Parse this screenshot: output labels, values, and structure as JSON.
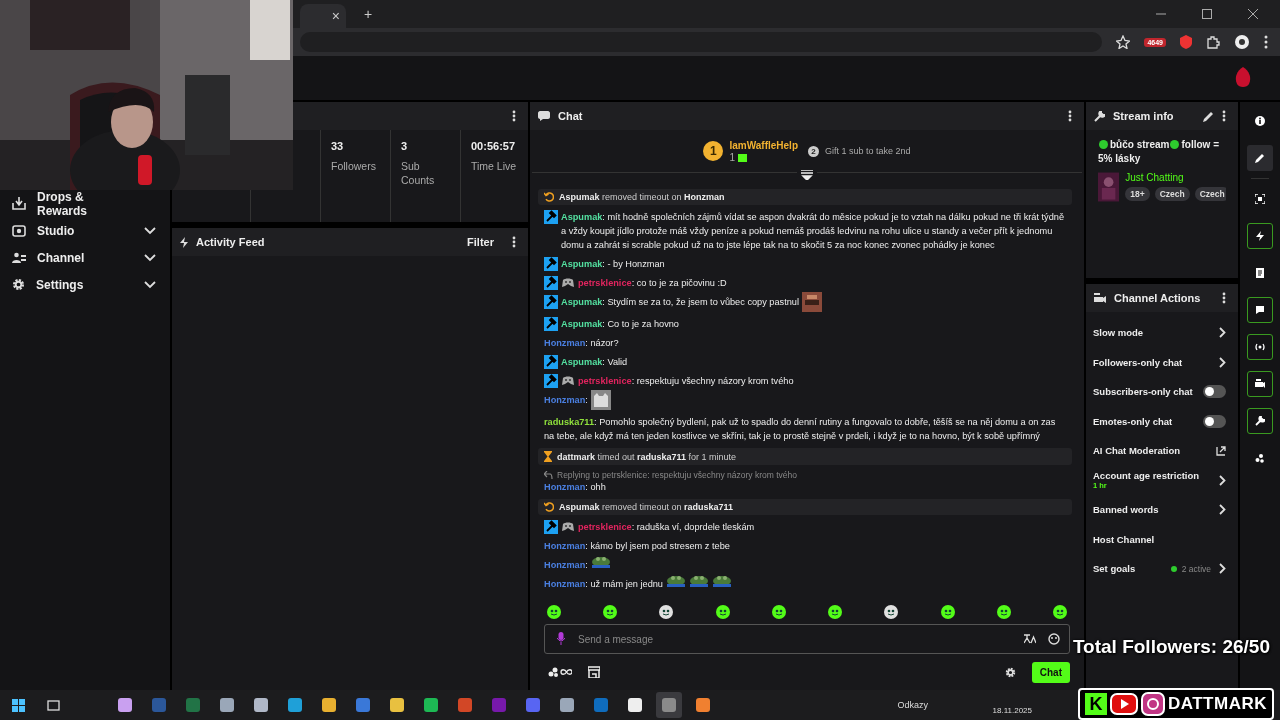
{
  "browser": {
    "tab_close": "×",
    "new_tab": "+",
    "extension_badge": "4649"
  },
  "sidebar": {
    "items": [
      {
        "label": "Drops & Rewards",
        "expandable": false
      },
      {
        "label": "Studio",
        "expandable": true
      },
      {
        "label": "Channel",
        "expandable": true
      },
      {
        "label": "Settings",
        "expandable": true
      }
    ]
  },
  "stats": [
    {
      "value": "33",
      "label": "Followers"
    },
    {
      "value": "3",
      "label": "Sub Counts"
    },
    {
      "value": "00:56:57",
      "label": "Time Live"
    }
  ],
  "activity_feed": {
    "title": "Activity Feed",
    "filter": "Filter"
  },
  "chat": {
    "title": "Chat",
    "leaderboard": {
      "rank": "1",
      "name": "IamWaffleHelp",
      "count": "1",
      "next_rank": "2",
      "hint": "Gift 1 sub to take 2nd"
    },
    "messages": [
      {
        "kind": "unban",
        "text": "**Aspumak** removed timeout on **Honzman**"
      },
      {
        "kind": "message",
        "mod": true,
        "extra_badge": false,
        "user": "Aspumak",
        "color": "#53e0a0",
        "text": ": mít hodně společních zájmů vídat se aspon dvakrát do měsice pokud je to vztah na dálku pokud ne tři krát týdně a vždy koupit jídlo protože máš vždy peníze a pokud nemáš prodáš ledvinu na rohu ulice u standy a večer přít k jednomu domu a zahrát si scrable pokud už na to jste lépe tak na to skočit 5 za noc konec zvonec pohádky je konec"
      },
      {
        "kind": "message",
        "mod": true,
        "extra_badge": false,
        "user": "Aspumak",
        "color": "#53e0a0",
        "text": ": - by Honzman"
      },
      {
        "kind": "message",
        "mod": true,
        "extra_badge": true,
        "user": "petrsklenice",
        "color": "#e0245e",
        "text": ": co to je za pičovinu :D"
      },
      {
        "kind": "message",
        "mod": true,
        "extra_badge": false,
        "user": "Aspumak",
        "color": "#53e0a0",
        "text": ": Stydím se za to, že jsem to vůbec copy pastnul",
        "emotes": [
          {
            "kind": "face"
          }
        ]
      },
      {
        "kind": "message",
        "mod": true,
        "extra_badge": false,
        "user": "Aspumak",
        "color": "#53e0a0",
        "text": ": Co to je za hovno"
      },
      {
        "kind": "message",
        "mod": false,
        "extra_badge": false,
        "user": "Honzman",
        "color": "#4a7fe0",
        "text": ": názor?"
      },
      {
        "kind": "message",
        "mod": true,
        "extra_badge": false,
        "user": "Aspumak",
        "color": "#53e0a0",
        "text": ": Valid"
      },
      {
        "kind": "message",
        "mod": true,
        "extra_badge": true,
        "user": "petrsklenice",
        "color": "#e0245e",
        "text": ": respektuju všechny názory krom tvého"
      },
      {
        "kind": "message",
        "mod": false,
        "extra_badge": false,
        "user": "Honzman",
        "color": "#4a7fe0",
        "text": ":",
        "emotes": [
          {
            "kind": "cat"
          }
        ]
      },
      {
        "kind": "message",
        "mod": false,
        "extra_badge": false,
        "user": "raduska711",
        "color": "#8fe03c",
        "text": ": Pomohlo společný bydlení, pak už to spadlo do denní rutiny a fungovalo to dobře, těšíš se na něj domu a on zas na tebe, ale když má ten jeden kostlivce ve skříni, tak je to prostě stejně v prdeli, i když je to na hovno, být k sobě upřímný"
      },
      {
        "kind": "timeout",
        "text": "**dattmark** timed out **raduska711** for 1 minute"
      },
      {
        "kind": "message",
        "mod": false,
        "extra_badge": false,
        "reply": "Replying to petrsklenice: respektuju všechny názory krom tvého",
        "user": "Honzman",
        "color": "#4a7fe0",
        "text": ": ohh"
      },
      {
        "kind": "unban",
        "text": "**Aspumak** removed timeout on **raduska711**"
      },
      {
        "kind": "message",
        "mod": true,
        "extra_badge": true,
        "user": "petrsklenice",
        "color": "#e0245e",
        "text": ": raduška ví, doprdele tleskám"
      },
      {
        "kind": "message",
        "mod": false,
        "extra_badge": false,
        "user": "Honzman",
        "color": "#4a7fe0",
        "text": ": kámo byl jsem pod stresem z tebe"
      },
      {
        "kind": "message",
        "mod": false,
        "extra_badge": false,
        "user": "Honzman",
        "color": "#4a7fe0",
        "text": ":",
        "emotes": [
          {
            "kind": "frog"
          }
        ]
      },
      {
        "kind": "message",
        "mod": false,
        "extra_badge": false,
        "user": "Honzman",
        "color": "#4a7fe0",
        "text": ": už mám jen jednu",
        "emotes": [
          {
            "kind": "frog"
          },
          {
            "kind": "frog"
          },
          {
            "kind": "frog"
          }
        ]
      }
    ],
    "input": {
      "placeholder": "Send a message"
    },
    "send": "Chat"
  },
  "stream_info": {
    "title": "Stream info",
    "title_parts": [
      "bůčo stream",
      "follow = 5% lásky"
    ],
    "category": "Just Chatting",
    "tags": [
      "18+",
      "Czech",
      "Czech"
    ]
  },
  "channel_actions": {
    "title": "Channel Actions",
    "items": [
      {
        "label": "Slow mode",
        "kind": "arrow"
      },
      {
        "label": "Followers-only chat",
        "kind": "arrow"
      },
      {
        "label": "Subscribers-only chat",
        "kind": "toggle",
        "on": false
      },
      {
        "label": "Emotes-only chat",
        "kind": "toggle",
        "on": false
      },
      {
        "label": "AI Chat Moderation",
        "kind": "external"
      },
      {
        "label": "Account age restriction",
        "kind": "arrow",
        "detail": "1 hr"
      },
      {
        "label": "Banned words",
        "kind": "arrow"
      },
      {
        "label": "Host Channel",
        "kind": "plain"
      },
      {
        "label": "Set goals",
        "kind": "arrow",
        "status": "2 active"
      }
    ]
  },
  "rail": [
    {
      "selected": false,
      "active": false
    },
    {
      "selected": true,
      "active": false
    },
    {
      "selected": false,
      "active": false
    },
    {
      "selected": false,
      "active": true
    },
    {
      "selected": false,
      "active": false
    },
    {
      "selected": false,
      "active": true
    },
    {
      "selected": false,
      "active": true
    },
    {
      "selected": false,
      "active": true
    },
    {
      "selected": false,
      "active": true
    },
    {
      "selected": false,
      "active": false
    }
  ],
  "taskbar": {
    "apps": [
      {
        "selected": false
      },
      {
        "selected": false
      },
      {
        "selected": false
      },
      {
        "selected": false
      },
      {
        "selected": false
      },
      {
        "selected": false
      },
      {
        "selected": false
      },
      {
        "selected": false
      },
      {
        "selected": false
      },
      {
        "selected": false
      },
      {
        "selected": false
      },
      {
        "selected": false
      },
      {
        "selected": false
      },
      {
        "selected": false
      },
      {
        "selected": false
      },
      {
        "selected": false
      },
      {
        "selected": true
      },
      {
        "selected": false
      }
    ],
    "links": "Odkazy",
    "date": "18.11.2025"
  },
  "overlay": {
    "followers_goal": "Total Followers: 26/50",
    "logo_letter": "K",
    "handle": "DATTMARK"
  }
}
